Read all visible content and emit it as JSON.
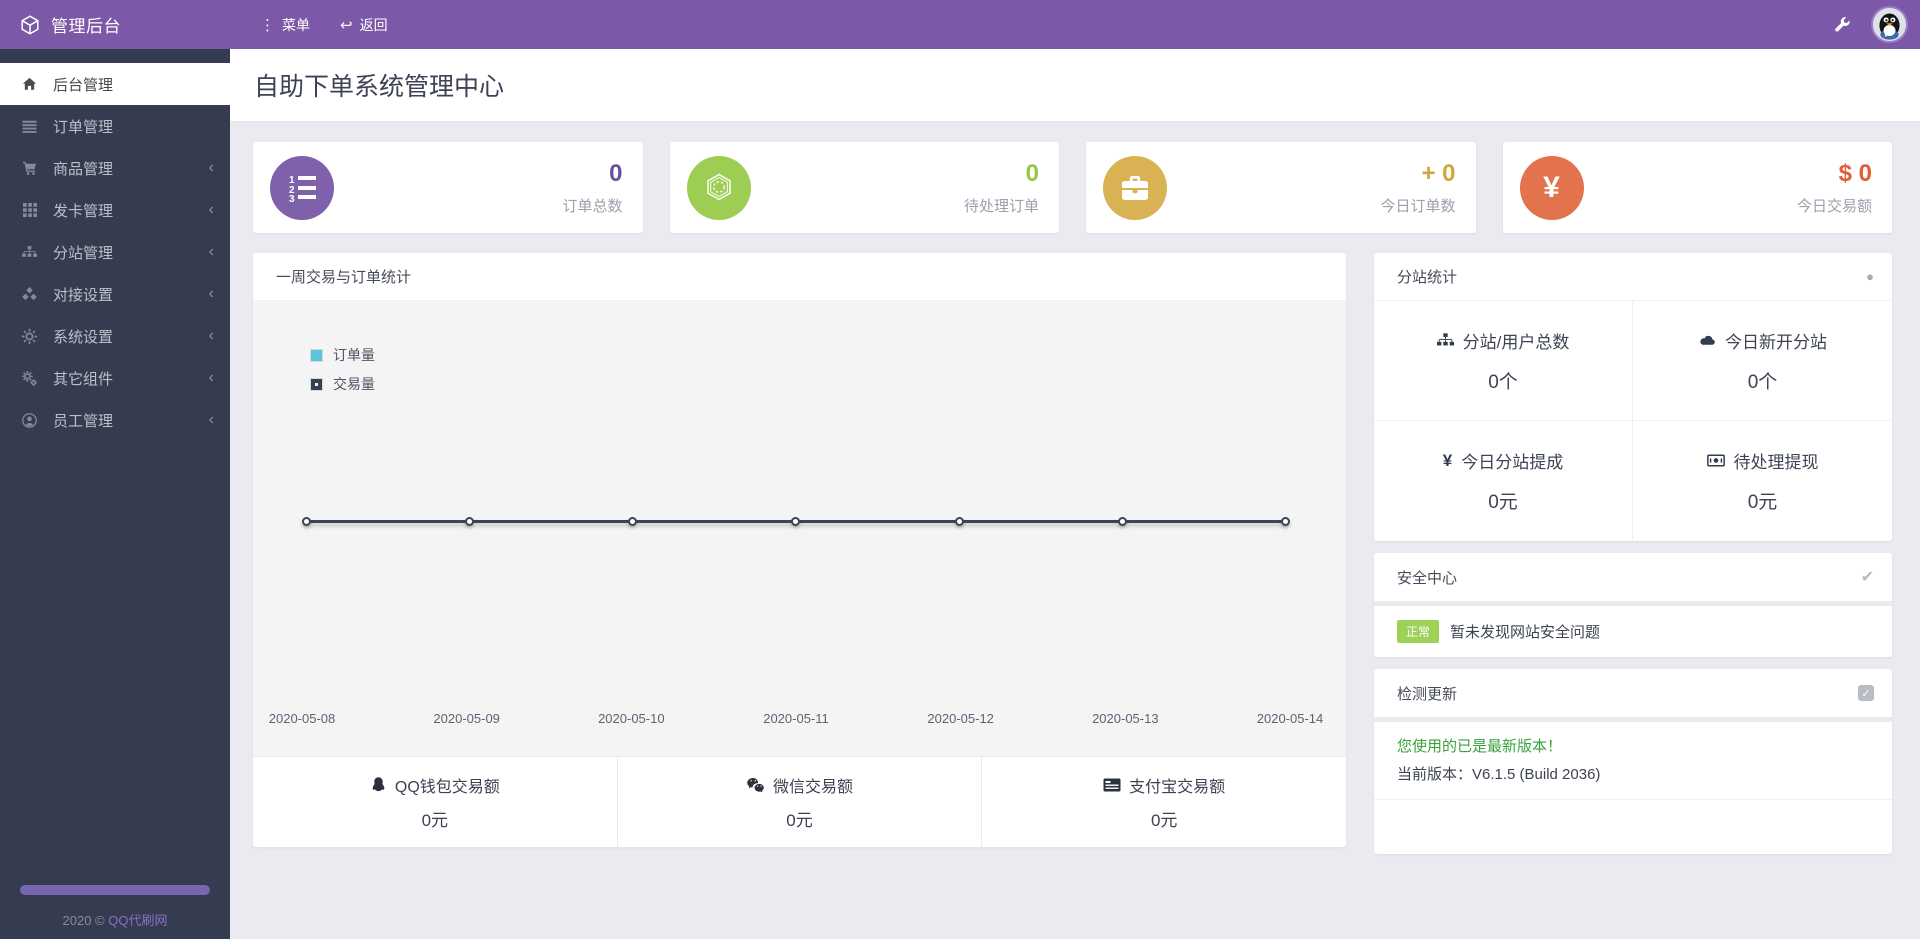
{
  "topbar": {
    "brand": "管理后台",
    "menu_label": "菜单",
    "menu_glyph": "⋮",
    "back_label": "返回",
    "back_glyph": "↩",
    "accent_color": "#7c59a8"
  },
  "sidebar": {
    "chevron": "‹",
    "items": [
      {
        "label": "后台管理",
        "icon": "home-icon",
        "active": true
      },
      {
        "label": "订单管理",
        "icon": "list-icon",
        "active": false
      },
      {
        "label": "商品管理",
        "icon": "cart-icon",
        "active": false
      },
      {
        "label": "发卡管理",
        "icon": "grid-icon",
        "active": false
      },
      {
        "label": "分站管理",
        "icon": "sitemap-icon",
        "active": false
      },
      {
        "label": "对接设置",
        "icon": "cubes-icon",
        "active": false
      },
      {
        "label": "系统设置",
        "icon": "gear-icon",
        "active": false
      },
      {
        "label": "其它组件",
        "icon": "cogs-icon",
        "active": false
      },
      {
        "label": "员工管理",
        "icon": "user-circle-icon",
        "active": false
      }
    ],
    "footer_text": "2020 © ",
    "footer_link": "QQ代刷网"
  },
  "page": {
    "title": "自助下单系统管理中心"
  },
  "stats": [
    {
      "value": "0",
      "label": "订单总数",
      "icon": "ordered-list-icon",
      "accent": "#7e60ab",
      "value_color": "#6a4f9f"
    },
    {
      "value": "0",
      "label": "待处理订单",
      "icon": "hexagon-icon",
      "accent": "#9dcd52",
      "value_color": "#94c943"
    },
    {
      "value": "+ 0",
      "label": "今日订单数",
      "icon": "briefcase-icon",
      "accent": "#d9b254",
      "value_color": "#d2a63e"
    },
    {
      "value": "$ 0",
      "label": "今日交易额",
      "icon": "yen-icon",
      "accent": "#e2734d",
      "value_color": "#e25c36"
    }
  ],
  "chart_card": {
    "title": "一周交易与订单统计"
  },
  "chart_data": {
    "type": "line",
    "title": "一周交易与订单统计",
    "x": [
      "2020-05-08",
      "2020-05-09",
      "2020-05-10",
      "2020-05-11",
      "2020-05-12",
      "2020-05-13",
      "2020-05-14"
    ],
    "series": [
      {
        "name": "订单量",
        "values": [
          0,
          0,
          0,
          0,
          0,
          0,
          0
        ],
        "color": "#57c5e0"
      },
      {
        "name": "交易量",
        "values": [
          0,
          0,
          0,
          0,
          0,
          0,
          0
        ],
        "color": "#364150"
      }
    ],
    "legend_position": "top-left",
    "grid": false,
    "ylim": [
      0,
      1
    ],
    "xlabel": "",
    "ylabel": ""
  },
  "payments": [
    {
      "icon": "qq-icon",
      "label": "QQ钱包交易额",
      "value": "0元"
    },
    {
      "icon": "wechat-icon",
      "label": "微信交易额",
      "value": "0元"
    },
    {
      "icon": "card-icon",
      "label": "支付宝交易额",
      "value": "0元"
    }
  ],
  "substation": {
    "title": "分站统计",
    "cells": [
      {
        "icon": "sitemap-icon",
        "label": "分站/用户总数",
        "value": "0个"
      },
      {
        "icon": "cloud-icon",
        "label": "今日新开分站",
        "value": "0个"
      },
      {
        "icon": "yen-icon",
        "label": "今日分站提成",
        "value": "0元"
      },
      {
        "icon": "bill-icon",
        "label": "待处理提现",
        "value": "0元"
      }
    ]
  },
  "security": {
    "title": "安全中心",
    "badge": "正常",
    "badge_color": "#9ed158",
    "message": "暂未发现网站安全问题"
  },
  "update": {
    "title": "检测更新",
    "status_line": "您使用的已是最新版本！",
    "status_color": "#39a23c",
    "version_line": "当前版本：V6.1.5 (Build 2036)"
  }
}
